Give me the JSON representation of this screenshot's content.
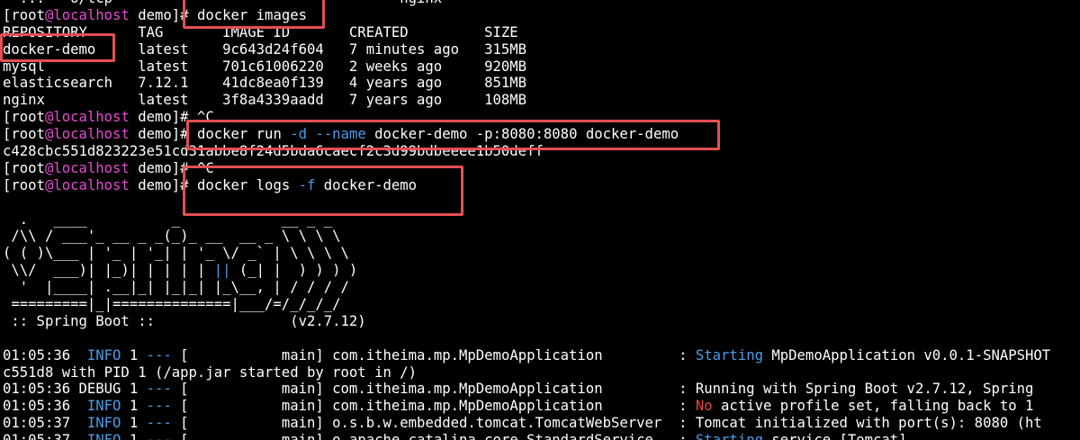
{
  "colors": {
    "background": "#000000",
    "foreground": "#ffffff",
    "host": "#e64bd2",
    "info": "#4a9de8",
    "separator": "#4a9de8",
    "option": "#4a9de8",
    "warning": "#e04646",
    "highlight_box": "#e54f53"
  },
  "prompt": {
    "open": "[root",
    "at": "@",
    "host": "localhost",
    "close": " demo]# "
  },
  "lines": [
    {
      "segments": [
        {
          "text": "  ...  -o/tcp                                  nginx",
          "cls": ""
        }
      ]
    },
    {
      "prompt": true,
      "segments": [
        {
          "text": "docker images",
          "cls": ""
        }
      ]
    },
    {
      "segments": [
        {
          "text": "REPOSITORY      TAG       IMAGE ID       CREATED         SIZE",
          "cls": ""
        }
      ]
    },
    {
      "segments": [
        {
          "text": "docker-demo     latest    9c643d24f604   7 minutes ago   315MB",
          "cls": ""
        }
      ]
    },
    {
      "segments": [
        {
          "text": "mysql           latest    701c61006220   2 weeks ago     920MB",
          "cls": ""
        }
      ]
    },
    {
      "segments": [
        {
          "text": "elasticsearch   7.12.1    41dc8ea0f139   4 years ago     851MB",
          "cls": ""
        }
      ]
    },
    {
      "segments": [
        {
          "text": "nginx           latest    3f8a4339aadd   7 years ago     108MB",
          "cls": ""
        }
      ]
    },
    {
      "prompt": true,
      "segments": [
        {
          "text": "^C",
          "cls": ""
        }
      ]
    },
    {
      "prompt": true,
      "segments": [
        {
          "text": "docker run ",
          "cls": ""
        },
        {
          "text": "-d",
          "cls": "blue"
        },
        {
          "text": " ",
          "cls": ""
        },
        {
          "text": "--name",
          "cls": "blue"
        },
        {
          "text": " docker-demo -p:8080:8080 docker-demo",
          "cls": ""
        }
      ]
    },
    {
      "segments": [
        {
          "text": "c428cbc551d823223e51cd31abbe8f24d5bda6caecf2c3d99bdbeeee1b50deff",
          "cls": ""
        }
      ]
    },
    {
      "prompt": true,
      "segments": [
        {
          "text": "^C",
          "cls": ""
        }
      ]
    },
    {
      "prompt": true,
      "segments": [
        {
          "text": "docker logs ",
          "cls": ""
        },
        {
          "text": "-f",
          "cls": "blue"
        },
        {
          "text": " docker-demo",
          "cls": ""
        }
      ]
    },
    {
      "segments": [
        {
          "text": "",
          "cls": ""
        }
      ]
    },
    {
      "segments": [
        {
          "text": "  .   ____          _            __ _ _",
          "cls": ""
        }
      ]
    },
    {
      "segments": [
        {
          "text": " /\\\\ / ___'_ __ _ _(_)_ __  __ _ \\ \\ \\ \\",
          "cls": ""
        }
      ]
    },
    {
      "segments": [
        {
          "text": "( ( )\\___ | '_ | '_| | '_ \\/ _` | \\ \\ \\ \\",
          "cls": ""
        }
      ]
    },
    {
      "segments": [
        {
          "text": " \\\\/  ___)| |_)| | | | | ",
          "cls": ""
        },
        {
          "text": "||",
          "cls": "blue"
        },
        {
          "text": " (_| |  ) ) ) )",
          "cls": ""
        }
      ]
    },
    {
      "segments": [
        {
          "text": "  '  |____| .__|_| |_|_| |_\\__, | / / / /",
          "cls": ""
        }
      ]
    },
    {
      "segments": [
        {
          "text": " =========|_|==============|___/=/_/_/_/",
          "cls": ""
        }
      ]
    },
    {
      "segments": [
        {
          "text": " :: Spring Boot ::                (v2.7.12)",
          "cls": ""
        }
      ]
    },
    {
      "segments": [
        {
          "text": "",
          "cls": ""
        }
      ]
    },
    {
      "segments": [
        {
          "text": "01:05:36  ",
          "cls": ""
        },
        {
          "text": "INFO",
          "cls": "blue"
        },
        {
          "text": " 1 ",
          "cls": ""
        },
        {
          "text": "---",
          "cls": "blue"
        },
        {
          "text": " [           main] com.itheima.mp.MpDemoApplication         : ",
          "cls": ""
        },
        {
          "text": "Starting",
          "cls": "blue"
        },
        {
          "text": " MpDemoApplication v0.0.1-SNAPSHOT",
          "cls": ""
        }
      ]
    },
    {
      "segments": [
        {
          "text": "c551d8 with PID 1 (/app.jar started by root in /)",
          "cls": ""
        }
      ]
    },
    {
      "segments": [
        {
          "text": "01:05:36 DEBUG 1 ",
          "cls": ""
        },
        {
          "text": "---",
          "cls": "blue"
        },
        {
          "text": " [           main] com.itheima.mp.MpDemoApplication         : Running with Spring Boot v2.7.12, Spring",
          "cls": ""
        }
      ]
    },
    {
      "segments": [
        {
          "text": "01:05:36  ",
          "cls": ""
        },
        {
          "text": "INFO",
          "cls": "blue"
        },
        {
          "text": " 1 ",
          "cls": ""
        },
        {
          "text": "---",
          "cls": "blue"
        },
        {
          "text": " [           main] com.itheima.mp.MpDemoApplication         : ",
          "cls": ""
        },
        {
          "text": "No",
          "cls": "red"
        },
        {
          "text": " active profile set, falling back to 1",
          "cls": ""
        }
      ]
    },
    {
      "segments": [
        {
          "text": "01:05:37  ",
          "cls": ""
        },
        {
          "text": "INFO",
          "cls": "blue"
        },
        {
          "text": " 1 ",
          "cls": ""
        },
        {
          "text": "---",
          "cls": "blue"
        },
        {
          "text": " [           main] o.s.b.w.embedded.tomcat.TomcatWebServer  : Tomcat initialized with port(s): 8080 (ht",
          "cls": ""
        }
      ]
    },
    {
      "segments": [
        {
          "text": "01:05:37  ",
          "cls": ""
        },
        {
          "text": "INFO",
          "cls": "blue"
        },
        {
          "text": " 1 ",
          "cls": ""
        },
        {
          "text": "---",
          "cls": "blue"
        },
        {
          "text": " [           main] o.apache.catalina.core.StandardService   : ",
          "cls": ""
        },
        {
          "text": "Starting",
          "cls": "blue"
        },
        {
          "text": " service [Tomcat]",
          "cls": ""
        }
      ]
    }
  ]
}
